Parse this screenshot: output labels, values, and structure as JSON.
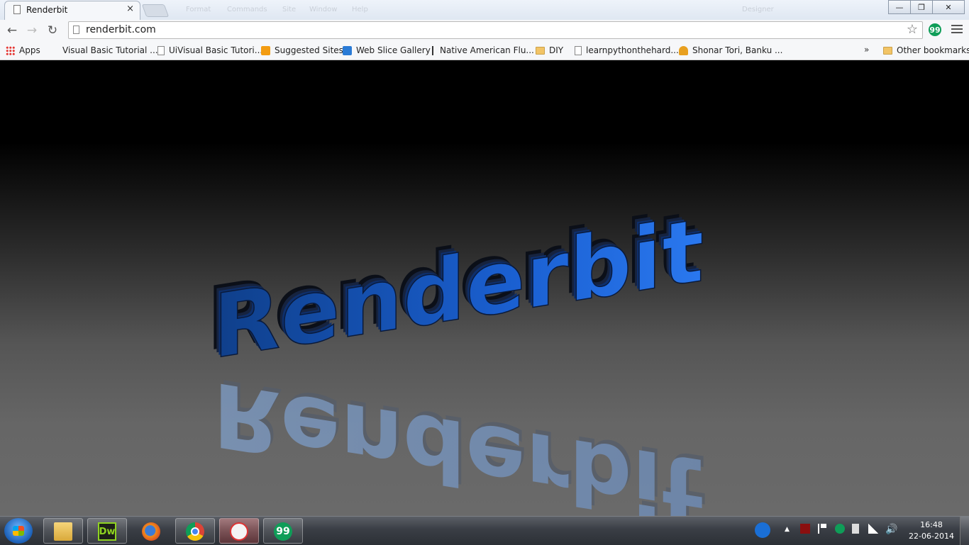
{
  "browser": {
    "tab_title": "Renderbit",
    "tab_close": "×",
    "url": "renderbit.com",
    "ext_icon_label": "99",
    "window_buttons": {
      "minimize": "—",
      "maximize": "❐",
      "close": "✕"
    },
    "ghost_menu": [
      "Format",
      "Commands",
      "Site",
      "Window",
      "Help",
      "Designer"
    ]
  },
  "bookmarks": {
    "items": [
      {
        "label": "Apps",
        "icon": "apps-grid-icon"
      },
      {
        "label": "Visual Basic Tutorial ...",
        "icon": "none"
      },
      {
        "label": "UiVisual Basic Tutori...",
        "icon": "page-icon"
      },
      {
        "label": "Suggested Sites",
        "icon": "bulb-icon"
      },
      {
        "label": "Web Slice Gallery",
        "icon": "ie-icon"
      },
      {
        "label": "Native American Flu...",
        "icon": "arrow-icon"
      },
      {
        "label": "DIY",
        "icon": "folder-icon"
      },
      {
        "label": "learnpythonthehard...",
        "icon": "page-icon"
      },
      {
        "label": "Shonar Tori, Banku ...",
        "icon": "pin-icon"
      }
    ],
    "more": "»",
    "other": "Other bookmarks"
  },
  "content": {
    "logo_text": "Renderbit",
    "logo_color": "#1f6fe0",
    "background_top": "#000000",
    "background_bottom": "#6a6a6a"
  },
  "taskbar": {
    "apps": [
      "Windows Explorer",
      "Dreamweaver",
      "Firefox",
      "Chrome",
      "Snipping Tool",
      "Hangouts"
    ],
    "dw_label": "Dw",
    "hangouts_label": "99",
    "tray_arrow": "▲",
    "time": "16:48",
    "date": "22-06-2014"
  }
}
